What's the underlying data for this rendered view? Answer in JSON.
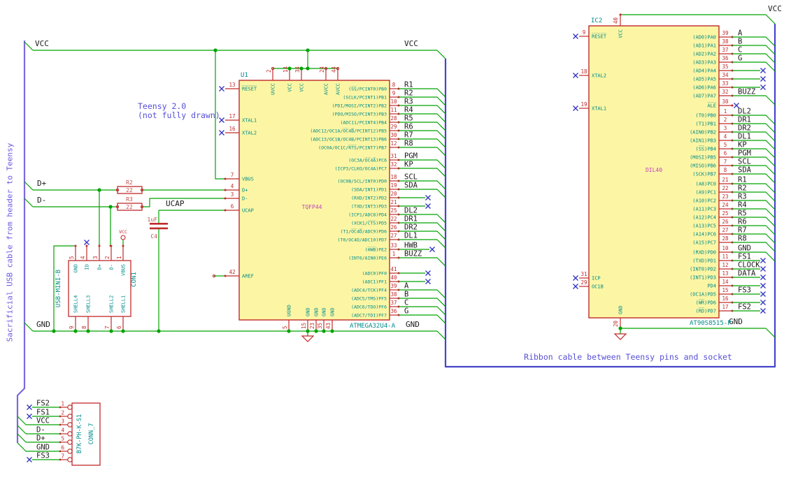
{
  "notes": {
    "teensy_line1": "Teensy 2.0",
    "teensy_line2": "(not fully drawn)",
    "usb_cable": "Sacrificial USB cable from header to Teensy",
    "ribbon": "Ribbon cable between Teensy pins and socket"
  },
  "rails": {
    "vcc_left": "VCC",
    "vcc_right": "VCC",
    "gnd_left": "GND",
    "gnd_right": "GND",
    "ic2_vcc": "VCC",
    "ic2_gnd": "GND",
    "d_plus": "D+",
    "d_minus": "D-",
    "ucap": "UCAP"
  },
  "components": {
    "u1": {
      "reference": "U1",
      "package": "TQFP44",
      "value": "ATMEGA32U4-A",
      "top_pins": [
        {
          "num": "2",
          "name": "UVCC"
        },
        {
          "num": "14",
          "name": "VCC"
        },
        {
          "num": "34",
          "name": "VCC"
        },
        {
          "num": "24",
          "name": "AVCC"
        },
        {
          "num": "44",
          "name": "AVCC"
        }
      ],
      "bottom_pins": [
        {
          "num": "5",
          "name": "UGND"
        },
        {
          "num": "15",
          "name": "GND"
        },
        {
          "num": "23",
          "name": "GND"
        },
        {
          "num": "35",
          "name": "GND"
        },
        {
          "num": "43",
          "name": "GND"
        }
      ],
      "left_pins": [
        {
          "num": "13",
          "name": "R̅E̅S̅E̅T̅",
          "nc": true
        },
        {
          "num": "17",
          "name": "XTAL1",
          "nc": true
        },
        {
          "num": "16",
          "name": "XTAL2",
          "nc": true
        },
        {
          "num": "7",
          "name": "VBUS"
        },
        {
          "num": "4",
          "name": "D+"
        },
        {
          "num": "3",
          "name": "D-"
        },
        {
          "num": "6",
          "name": "UCAP"
        },
        {
          "num": "42",
          "name": "AREF"
        }
      ],
      "right_groups": [
        {
          "pins": [
            {
              "num": "8",
              "name": "(S̅S̅/PCINT0)PB0",
              "label": "R1",
              "term": "bus"
            },
            {
              "num": "9",
              "name": "(SCLK/PCINT1)PB1",
              "label": "R2",
              "term": "bus"
            },
            {
              "num": "10",
              "name": "(PDI/MOSI/PCINT2)PB2",
              "label": "R3",
              "term": "bus"
            },
            {
              "num": "11",
              "name": "(PDO/MISO/PCINT3)PB3",
              "label": "R4",
              "term": "bus"
            },
            {
              "num": "28",
              "name": "(ADC11/PCINT4)PB4",
              "label": "R5",
              "term": "bus"
            },
            {
              "num": "29",
              "name": "(ADC12/OC1A/O̅C̅4̅B̅/PCINT12)PB5",
              "label": "R6",
              "term": "bus"
            },
            {
              "num": "30",
              "name": "(ADC13/OC1B/OC4B/PCINT13)PB6",
              "label": "R7",
              "term": "bus"
            },
            {
              "num": "12",
              "name": "(OC0A/OC1C/R̅T̅S̅/PCINT7)PB7",
              "label": "R8",
              "term": "bus"
            }
          ]
        },
        {
          "pins": [
            {
              "num": "31",
              "name": "(OC3A/O̅C̅4̅A̅)PC6",
              "label": "PGM",
              "term": "bus"
            },
            {
              "num": "32",
              "name": "(ICP3/CLKO/OC4A)PC7",
              "label": "KP",
              "term": "bus"
            }
          ]
        },
        {
          "pins": [
            {
              "num": "18",
              "name": "(OC0B/SCL/INT0)PD0",
              "label": "SCL",
              "term": "bus"
            },
            {
              "num": "19",
              "name": "(SDA/INT1)PD1",
              "label": "SDA",
              "term": "bus"
            },
            {
              "num": "20",
              "name": "(RXD/INT2)PD2",
              "label": "",
              "term": "nc"
            },
            {
              "num": "21",
              "name": "(TXD/INT3)PD3",
              "label": "",
              "term": "nc"
            },
            {
              "num": "25",
              "name": "(ICP1/ADC8)PD4",
              "label": "DL2",
              "term": "bus"
            },
            {
              "num": "22",
              "name": "(XCK1/C̅T̅S̅)PD5",
              "label": "DR1",
              "term": "bus"
            },
            {
              "num": "26",
              "name": "(T1/O̅C̅4̅D̅/ADC9)PD6",
              "label": "DR2",
              "term": "bus"
            },
            {
              "num": "27",
              "name": "(T0/OC4D/ADC10)PD7",
              "label": "DL1",
              "term": "bus"
            }
          ]
        },
        {
          "pins": [
            {
              "num": "33",
              "name": "(H̅W̅B̅)PE2",
              "label": "HWB",
              "term": "nc"
            },
            {
              "num": "1",
              "name": "(INT6/AIN0)PE6",
              "label": "BUZZ",
              "term": "bus"
            }
          ]
        },
        {
          "pins": [
            {
              "num": "41",
              "name": "(ADC0)PF0",
              "label": "",
              "term": "nc"
            },
            {
              "num": "40",
              "name": "(ADC1)PF1",
              "label": "",
              "term": "nc"
            },
            {
              "num": "39",
              "name": "(ADC4/TCK)PF4",
              "label": "A",
              "term": "bus"
            },
            {
              "num": "38",
              "name": "(ADC5/TMS)PF5",
              "label": "B",
              "term": "bus"
            },
            {
              "num": "37",
              "name": "(ADC6/TDO)PF6",
              "label": "C",
              "term": "bus"
            },
            {
              "num": "36",
              "name": "(ADC7/TDI)PF7",
              "label": "G",
              "term": "bus"
            }
          ]
        }
      ]
    },
    "ic2": {
      "reference": "IC2",
      "package": "DIL40",
      "value": "AT90S8515-P",
      "top_pin": {
        "num": "40",
        "name": "VCC"
      },
      "bottom_pin": {
        "num": "20",
        "name": "GND"
      },
      "left_pins": [
        {
          "num": "9",
          "name": "R̅E̅S̅E̅T̅"
        },
        {
          "num": "18",
          "name": "XTAL2"
        },
        {
          "num": "19",
          "name": "XTAL1"
        },
        {
          "num": "31",
          "name": "ICP"
        },
        {
          "num": "29",
          "name": "OC1B"
        }
      ],
      "right_groups": [
        {
          "pins": [
            {
              "num": "39",
              "name": "(AD0)PA0",
              "label": "A",
              "term": "bus"
            },
            {
              "num": "38",
              "name": "(AD1)PA1",
              "label": "B",
              "term": "bus"
            },
            {
              "num": "37",
              "name": "(AD2)PA2",
              "label": "C",
              "term": "bus"
            },
            {
              "num": "36",
              "name": "(AD3)PA3",
              "label": "G",
              "term": "bus"
            },
            {
              "num": "35",
              "name": "(AD4)PA4",
              "label": "",
              "term": "nc"
            },
            {
              "num": "34",
              "name": "(AD5)PA5",
              "label": "",
              "term": "nc"
            },
            {
              "num": "33",
              "name": "(AD6)PA6",
              "label": "",
              "term": "nc"
            },
            {
              "num": "32",
              "name": "(AD7)PA7",
              "label": "BUZZ",
              "term": "bus"
            }
          ]
        },
        {
          "pins": [
            {
              "num": "30",
              "name": "A̅L̅E̅",
              "label": "",
              "term": "ncpin"
            }
          ]
        },
        {
          "pins": [
            {
              "num": "1",
              "name": "(T0)PB0",
              "label": "DL2",
              "term": "bus"
            },
            {
              "num": "2",
              "name": "(T1)PB1",
              "label": "DR1",
              "term": "bus"
            },
            {
              "num": "3",
              "name": "(AIN0)PB2",
              "label": "DR2",
              "term": "bus"
            },
            {
              "num": "4",
              "name": "(AIN1)PB3",
              "label": "DL1",
              "term": "bus"
            },
            {
              "num": "5",
              "name": "(S̅S̅)PB4",
              "label": "KP",
              "term": "bus"
            },
            {
              "num": "6",
              "name": "(MOSI)PB5",
              "label": "PGM",
              "term": "bus"
            },
            {
              "num": "7",
              "name": "(MISO)PB6",
              "label": "SCL",
              "term": "bus"
            },
            {
              "num": "8",
              "name": "(SCK)PB7",
              "label": "SDA",
              "term": "bus"
            }
          ]
        },
        {
          "pins": [
            {
              "num": "21",
              "name": "(A8)PC0",
              "label": "R1",
              "term": "bus"
            },
            {
              "num": "22",
              "name": "(A9)PC1",
              "label": "R2",
              "term": "bus"
            },
            {
              "num": "23",
              "name": "(A10)PC2",
              "label": "R3",
              "term": "bus"
            },
            {
              "num": "24",
              "name": "(A11)PC3",
              "label": "R4",
              "term": "bus"
            },
            {
              "num": "25",
              "name": "(A12)PC4",
              "label": "R5",
              "term": "bus"
            },
            {
              "num": "26",
              "name": "(A13)PC5",
              "label": "R6",
              "term": "bus"
            },
            {
              "num": "27",
              "name": "(A14)PC6",
              "label": "R7",
              "term": "bus"
            },
            {
              "num": "28",
              "name": "(A15)PC7",
              "label": "R8",
              "term": "bus"
            }
          ]
        },
        {
          "pins": [
            {
              "num": "10",
              "name": "(RXD)PD0",
              "label": "GND",
              "term": "bus"
            },
            {
              "num": "11",
              "name": "(TXD)PD1",
              "label": "FS1",
              "term": "nc"
            },
            {
              "num": "12",
              "name": "(INT0)PD2",
              "label": "CLOCK",
              "term": "nc"
            },
            {
              "num": "13",
              "name": "(INT1)PD3",
              "label": "DATA",
              "term": "nc"
            },
            {
              "num": "14",
              "name": "PD4",
              "label": "",
              "term": "nc"
            },
            {
              "num": "15",
              "name": "(OC1A)PD5",
              "label": "FS3",
              "term": "nc"
            },
            {
              "num": "16",
              "name": "(W̅R̅)PD6",
              "label": "",
              "term": "nc"
            },
            {
              "num": "17",
              "name": "(R̅D̅)PD7",
              "label": "FS2",
              "term": "nc"
            }
          ]
        }
      ]
    },
    "con1": {
      "reference": "CON1",
      "value": "USB-MINI-B",
      "top_pins": [
        {
          "num": "5",
          "name": "GND"
        },
        {
          "num": "4",
          "name": "ID"
        },
        {
          "num": "3",
          "name": "D+"
        },
        {
          "num": "2",
          "name": "D-"
        },
        {
          "num": "1",
          "name": "VBUS"
        }
      ],
      "bottom_pins": [
        {
          "num": "9",
          "name": "SHELL4"
        },
        {
          "num": "8",
          "name": "SHELL3"
        },
        {
          "num": "7",
          "name": "SHELL2"
        },
        {
          "num": "6",
          "name": "SHELL1"
        }
      ]
    },
    "conn7": {
      "reference": "CONN_7",
      "value": "B7K-PH-K-S1",
      "pins": [
        {
          "num": "1",
          "label": "FS2",
          "term": "nc"
        },
        {
          "num": "2",
          "label": "FS1",
          "term": "nc"
        },
        {
          "num": "3",
          "label": "VCC",
          "term": "bus"
        },
        {
          "num": "4",
          "label": "D-",
          "term": "bus"
        },
        {
          "num": "5",
          "label": "D+",
          "term": "bus"
        },
        {
          "num": "6",
          "label": "GND",
          "term": "bus"
        },
        {
          "num": "7",
          "label": "FS3",
          "term": "nc"
        }
      ]
    },
    "r2": {
      "reference": "R2",
      "value": "22"
    },
    "r3": {
      "reference": "R3",
      "value": "22"
    },
    "c4": {
      "reference": "C4",
      "value": "1uF"
    },
    "vcc_symbol": {
      "label": "VCC"
    }
  },
  "colors": {
    "wire": "#00a300",
    "bus": "#4444cc",
    "usb_bus": "#7d68dc",
    "component": "#c02a2a",
    "chip_fill": "#fcf6a4",
    "pin_name": "#008a8a",
    "pin_number": "#c02a2a",
    "reference": "#008a8a",
    "package_label": "#c040c0",
    "rvalue": "#c35050",
    "net_label": "#1a1a1a",
    "noconnect": "#3333c4"
  }
}
